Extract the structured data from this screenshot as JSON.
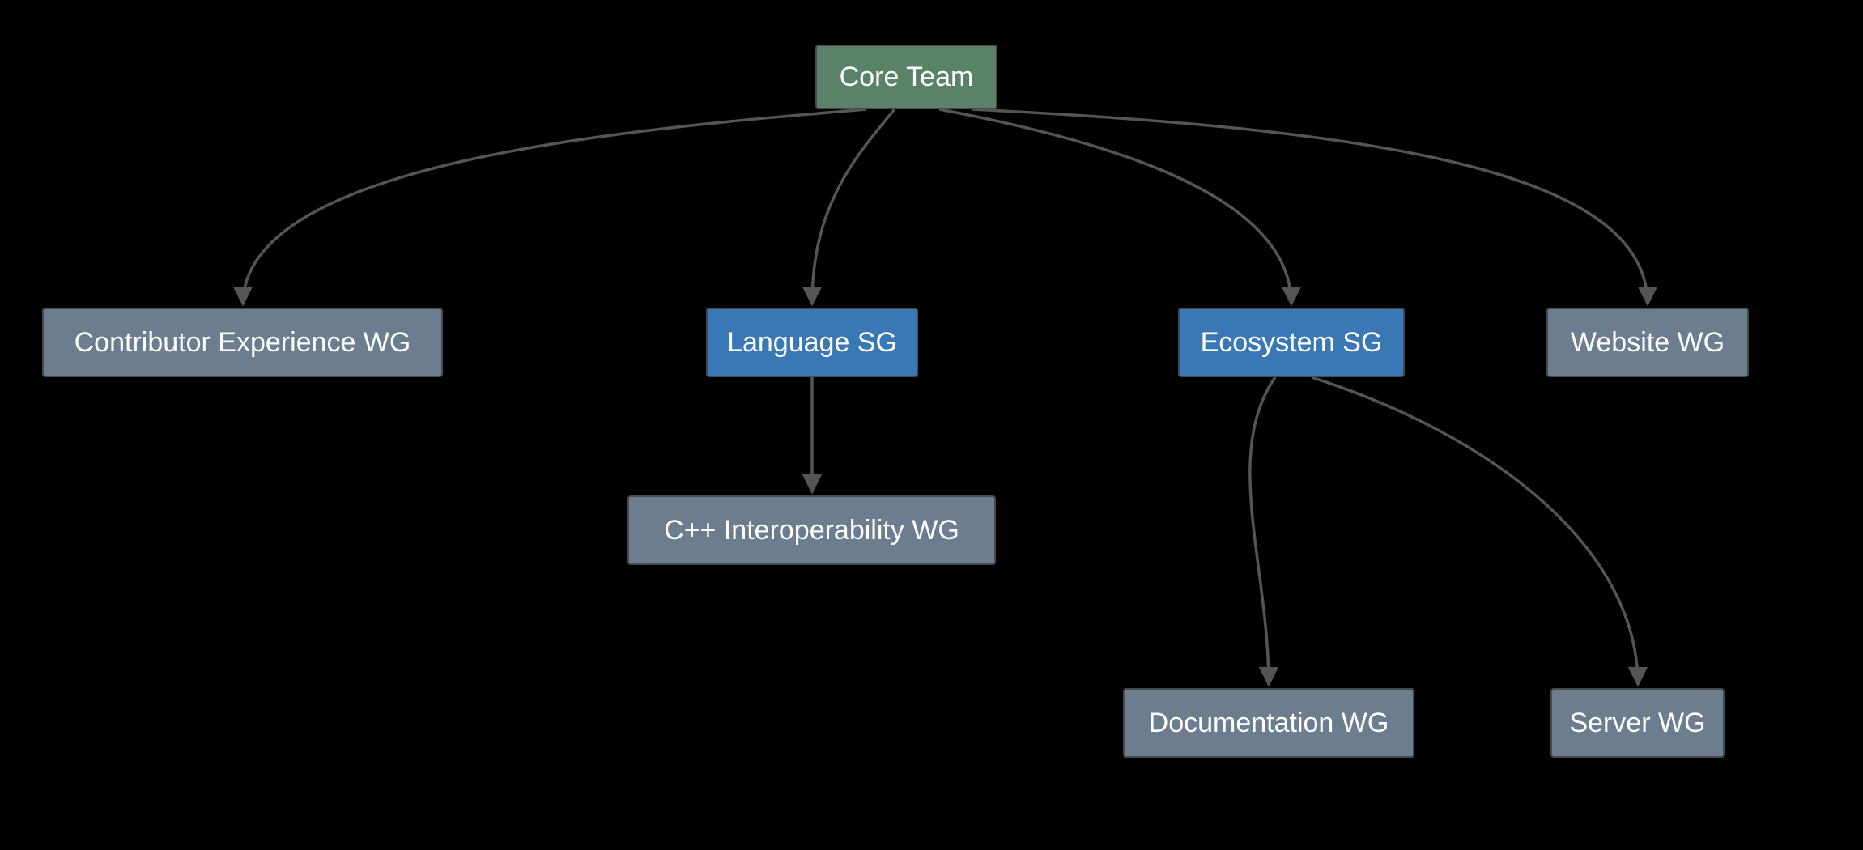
{
  "diagram": {
    "type": "org-chart",
    "nodes": {
      "core": {
        "label": "Core Team",
        "kind": "core",
        "color": "green"
      },
      "contrib": {
        "label": "Contributor Experience WG",
        "kind": "workgroup",
        "color": "gray"
      },
      "language": {
        "label": "Language SG",
        "kind": "steering-group",
        "color": "blue"
      },
      "ecosystem": {
        "label": "Ecosystem SG",
        "kind": "steering-group",
        "color": "blue"
      },
      "website": {
        "label": "Website WG",
        "kind": "workgroup",
        "color": "gray"
      },
      "cpp": {
        "label": "C++ Interoperability WG",
        "kind": "workgroup",
        "color": "gray"
      },
      "docs": {
        "label": "Documentation WG",
        "kind": "workgroup",
        "color": "gray"
      },
      "server": {
        "label": "Server WG",
        "kind": "workgroup",
        "color": "gray"
      }
    },
    "edges": [
      [
        "core",
        "contrib"
      ],
      [
        "core",
        "language"
      ],
      [
        "core",
        "ecosystem"
      ],
      [
        "core",
        "website"
      ],
      [
        "language",
        "cpp"
      ],
      [
        "ecosystem",
        "docs"
      ],
      [
        "ecosystem",
        "server"
      ]
    ],
    "colors": {
      "edge": "#555555",
      "node_border": "#4a4a4a",
      "green": "#5a8268",
      "blue": "#3a78b5",
      "gray": "#6b7d8f"
    }
  }
}
